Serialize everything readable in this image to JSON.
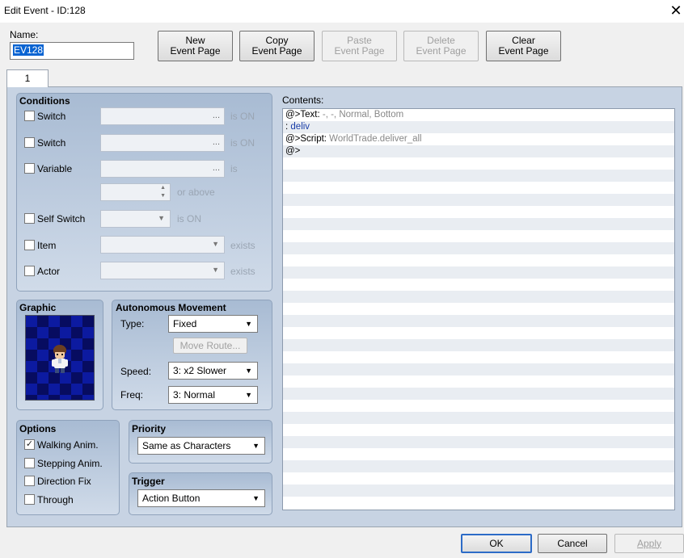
{
  "window": {
    "title": "Edit Event - ID:128",
    "close": "✕"
  },
  "name": {
    "label": "Name:",
    "value": "EV128"
  },
  "toolbar": {
    "new": [
      "New",
      "Event Page"
    ],
    "copy": [
      "Copy",
      "Event Page"
    ],
    "paste": [
      "Paste",
      "Event Page"
    ],
    "delete": [
      "Delete",
      "Event Page"
    ],
    "clear": [
      "Clear",
      "Event Page"
    ]
  },
  "tabs": [
    {
      "label": "1"
    }
  ],
  "conditions": {
    "title": "Conditions",
    "switch1": {
      "label": "Switch",
      "suffix": "is ON",
      "dots": "...",
      "checked": false
    },
    "switch2": {
      "label": "Switch",
      "suffix": "is ON",
      "dots": "...",
      "checked": false
    },
    "variable": {
      "label": "Variable",
      "suffix": "is",
      "dots": "...",
      "checked": false,
      "above": "or above"
    },
    "self_switch": {
      "label": "Self Switch",
      "suffix": "is ON",
      "checked": false
    },
    "item": {
      "label": "Item",
      "suffix": "exists",
      "checked": false
    },
    "actor": {
      "label": "Actor",
      "suffix": "exists",
      "checked": false
    }
  },
  "graphic": {
    "title": "Graphic"
  },
  "movement": {
    "title": "Autonomous Movement",
    "type_label": "Type:",
    "type_value": "Fixed",
    "move_route": "Move Route...",
    "speed_label": "Speed:",
    "speed_value": "3: x2 Slower",
    "freq_label": "Freq:",
    "freq_value": "3: Normal"
  },
  "options": {
    "title": "Options",
    "walking": {
      "label": "Walking Anim.",
      "checked": true,
      "mark": "✓"
    },
    "stepping": {
      "label": "Stepping Anim.",
      "checked": false
    },
    "direction_fix": {
      "label": "Direction Fix",
      "checked": false
    },
    "through": {
      "label": "Through",
      "checked": false
    }
  },
  "priority": {
    "title": "Priority",
    "value": "Same as Characters"
  },
  "trigger": {
    "title": "Trigger",
    "value": "Action Button"
  },
  "contents": {
    "label": "Contents:",
    "lines": [
      {
        "prefix": "@>Text:",
        "rest": " -, -, Normal, Bottom",
        "rest_style": "gray"
      },
      {
        "prefix": " :",
        "spacer": "      :",
        "rest": " deliv",
        "rest_style": "blue"
      },
      {
        "prefix": "@>Script:",
        "rest": " WorldTrade.deliver_all",
        "rest_style": "gray"
      },
      {
        "prefix": "@>",
        "rest": "",
        "rest_style": "gray"
      }
    ]
  },
  "footer": {
    "ok": "OK",
    "cancel": "Cancel",
    "apply": "Apply"
  },
  "icons": {
    "dots": "...",
    "dropdown": "▼",
    "spin_up": "▲",
    "spin_down": "▼"
  }
}
